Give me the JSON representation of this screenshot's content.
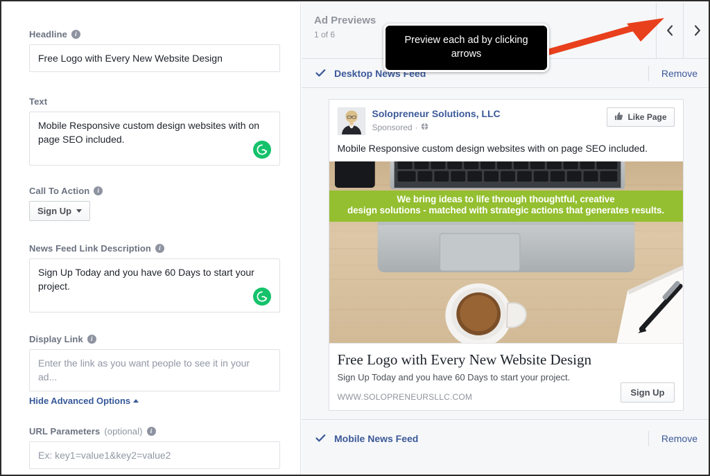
{
  "left_form": {
    "fields": [
      {
        "label": "Headline",
        "has_info": true,
        "value": "Free Logo with Every New Website Design",
        "placeholder": "",
        "type": "input"
      },
      {
        "label": "Text",
        "has_info": false,
        "value": "Mobile Responsive custom design websites with on page SEO included.",
        "placeholder": "",
        "type": "textarea",
        "grammarly_icon": "grammarly-g-icon"
      },
      {
        "label": "News Feed Link Description",
        "has_info": true,
        "value": "Sign Up Today and you have 60 Days to start your project.",
        "placeholder": "",
        "type": "textarea",
        "grammarly_icon": "grammarly-g-icon"
      },
      {
        "label": "Display Link",
        "has_info": true,
        "value": "",
        "placeholder": "Enter the link as you want people to see it in your ad...",
        "type": "input"
      },
      {
        "label": "URL Parameters",
        "label_optional": "(optional)",
        "has_info": true,
        "value": "",
        "placeholder": "Ex: key1=value1&key2=value2",
        "type": "input"
      }
    ],
    "call_to_action": {
      "label": "Call To Action",
      "selected": "Sign Up",
      "caret_icon": "caret-down-icon"
    },
    "advanced_options": {
      "label": "Hide Advanced Options",
      "caret_icon": "caret-up-icon"
    }
  },
  "preview_panel": {
    "title": "Ad Previews",
    "counter": "1 of 6",
    "prev_icon": "chevron-left-icon",
    "next_icon": "chevron-right-icon",
    "placements": [
      {
        "name": "Desktop News Feed",
        "check_icon": "checkmark-icon",
        "remove_label": "Remove"
      },
      {
        "name": "Mobile News Feed",
        "check_icon": "checkmark-icon",
        "remove_label": "Remove"
      }
    ]
  },
  "ad_preview": {
    "avatar_icon": "profile-photo-avatar",
    "page_name": "Solopreneur Solutions, LLC",
    "sponsored_label": "Sponsored",
    "sponsored_separator": "·",
    "globe_icon": "globe-icon",
    "like_button": {
      "label": "Like Page",
      "icon": "thumbs-up-icon"
    },
    "body_text": "Mobile Responsive custom design websites with on page SEO included.",
    "image": {
      "alt": "laptop-coffee-desk-photo",
      "banner_line1": "We bring ideas to life through thoughtful, creative",
      "banner_line2": "design solutions - matched with strategic actions that generates results.",
      "banner_color": "#94bf30"
    },
    "headline": "Free Logo with Every New Website Design",
    "description": "Sign Up Today and you have 60 Days to start your project.",
    "display_url": "WWW.SOLOPRENEURSLLC.COM",
    "cta_button": "Sign Up"
  },
  "annotations": {
    "tooltip_text": "Preview each ad by clicking arrows",
    "arrow_icon": "red-pointer-arrow",
    "arrow_color": "#e8401c"
  },
  "colors": {
    "link_blue": "#3b5998",
    "label_gray": "#6b7280",
    "panel_bg": "#f6f7f9",
    "grammarly_green": "#15c26b",
    "banner_green": "#94bf30"
  }
}
